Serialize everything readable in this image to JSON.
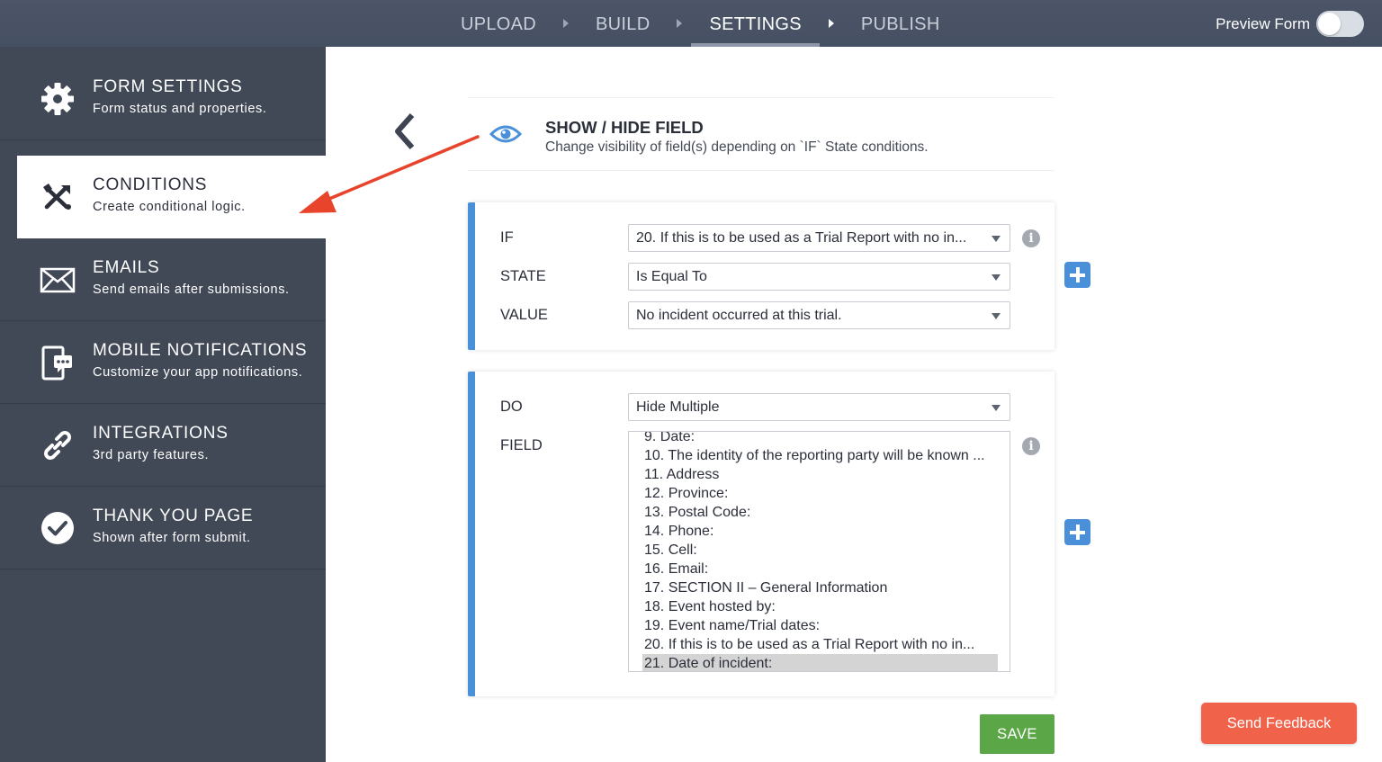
{
  "topbar": {
    "steps": [
      "UPLOAD",
      "BUILD",
      "SETTINGS",
      "PUBLISH"
    ],
    "active_step": "SETTINGS",
    "preview_label": "Preview Form",
    "preview_on": false
  },
  "sidebar": {
    "items": [
      {
        "title": "FORM SETTINGS",
        "subtitle": "Form status and properties.",
        "icon": "gear-icon"
      },
      {
        "title": "CONDITIONS",
        "subtitle": "Create conditional logic.",
        "icon": "conditions-icon"
      },
      {
        "title": "EMAILS",
        "subtitle": "Send emails after submissions.",
        "icon": "envelope-icon"
      },
      {
        "title": "MOBILE NOTIFICATIONS",
        "subtitle": "Customize your app notifications.",
        "icon": "mobile-notification-icon"
      },
      {
        "title": "INTEGRATIONS",
        "subtitle": "3rd party features.",
        "icon": "link-icon"
      },
      {
        "title": "THANK YOU PAGE",
        "subtitle": "Shown after form submit.",
        "icon": "checkmark-icon"
      }
    ],
    "active_index": 1
  },
  "header": {
    "title": "SHOW / HIDE FIELD",
    "subtitle": "Change visibility of field(s) depending on `IF` State conditions.",
    "icon": "eye-icon"
  },
  "condition": {
    "if_label": "IF",
    "if_value": "20. If this is to be used as a Trial Report with no in...",
    "state_label": "STATE",
    "state_value": "Is Equal To",
    "value_label": "VALUE",
    "value_value": "No incident occurred at this trial."
  },
  "action": {
    "do_label": "DO",
    "do_value": "Hide Multiple",
    "field_label": "FIELD",
    "fields": [
      "9. Date:",
      "10. The identity of the reporting party will be known ...",
      "11. Address",
      "12. Province:",
      "13. Postal Code:",
      "14. Phone:",
      "15. Cell:",
      "16. Email:",
      "17. SECTION II – General Information",
      "18. Event hosted by:",
      "19. Event name/Trial dates:",
      "20. If this is to be used as a Trial Report with no in...",
      "21. Date of incident:"
    ],
    "selected_field": "21. Date of incident:"
  },
  "buttons": {
    "save": "SAVE",
    "feedback": "Send Feedback"
  },
  "colors": {
    "topbar": "#4c5567",
    "sidebar": "#414856",
    "accent_blue": "#4a90d9",
    "save_green": "#5ba646",
    "feedback_red": "#f0624a",
    "annotation_arrow": "#e8432b"
  }
}
